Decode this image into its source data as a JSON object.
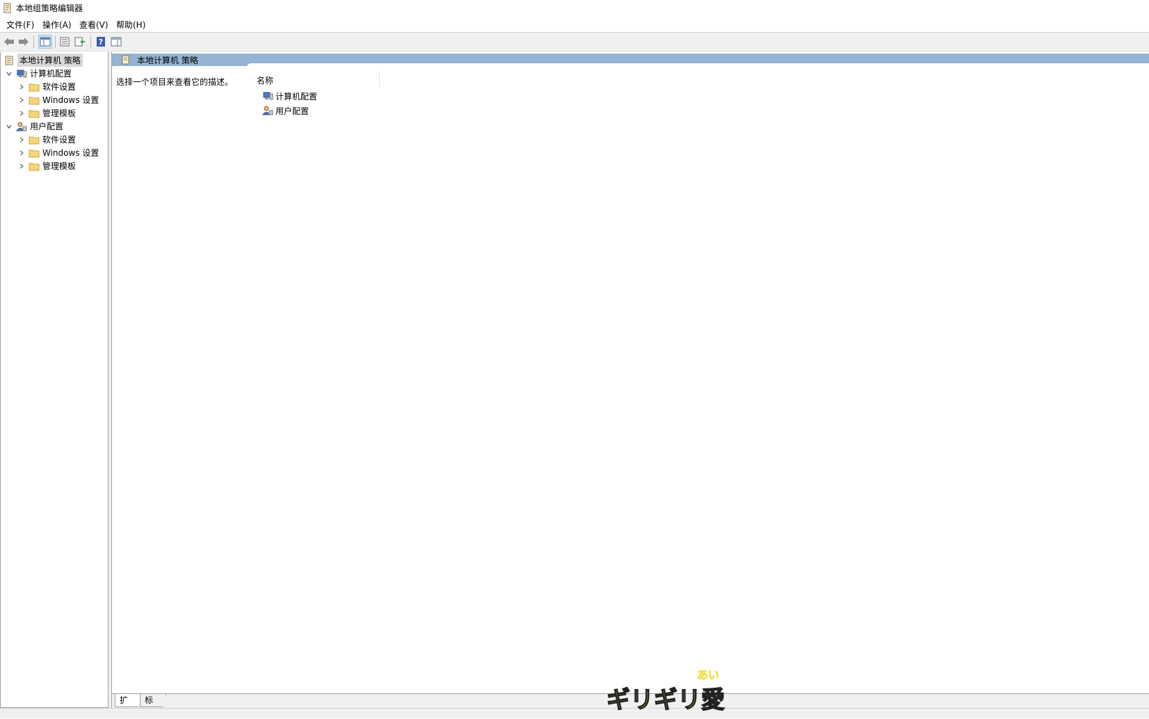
{
  "window": {
    "title": "本地组策略编辑器"
  },
  "menu": [
    {
      "label": "文件(F)"
    },
    {
      "label": "操作(A)"
    },
    {
      "label": "查看(V)"
    },
    {
      "label": "帮助(H)"
    }
  ],
  "toolbar": {
    "buttons": [
      {
        "icon": "back-arrow-icon"
      },
      {
        "icon": "forward-arrow-icon"
      },
      {
        "icon": "show-hide-console-tree-icon"
      },
      {
        "icon": "properties-list-icon"
      },
      {
        "icon": "export-list-icon"
      },
      {
        "icon": "help-icon"
      },
      {
        "icon": "show-hide-action-pane-icon"
      }
    ]
  },
  "tree": {
    "root": "本地计算机 策略",
    "computer_config": "计算机配置",
    "user_config": "用户配置",
    "software_settings": "软件设置",
    "windows_settings": "Windows 设置",
    "admin_templates": "管理模板"
  },
  "main": {
    "header_title": "本地计算机 策略",
    "description": "选择一个项目来查看它的描述。",
    "column_name": "名称",
    "items": [
      {
        "label": "计算机配置"
      },
      {
        "label": "用户配置"
      }
    ]
  },
  "tabs": [
    {
      "label": "扩展"
    },
    {
      "label": "标准"
    }
  ],
  "overlay": {
    "ruby": "あい",
    "text": "ギリギリ愛"
  },
  "colors": {
    "header_blue": "#95b3d3",
    "folder_yellow": "#f5d77a",
    "logo_yellow": "#f4e04d"
  }
}
